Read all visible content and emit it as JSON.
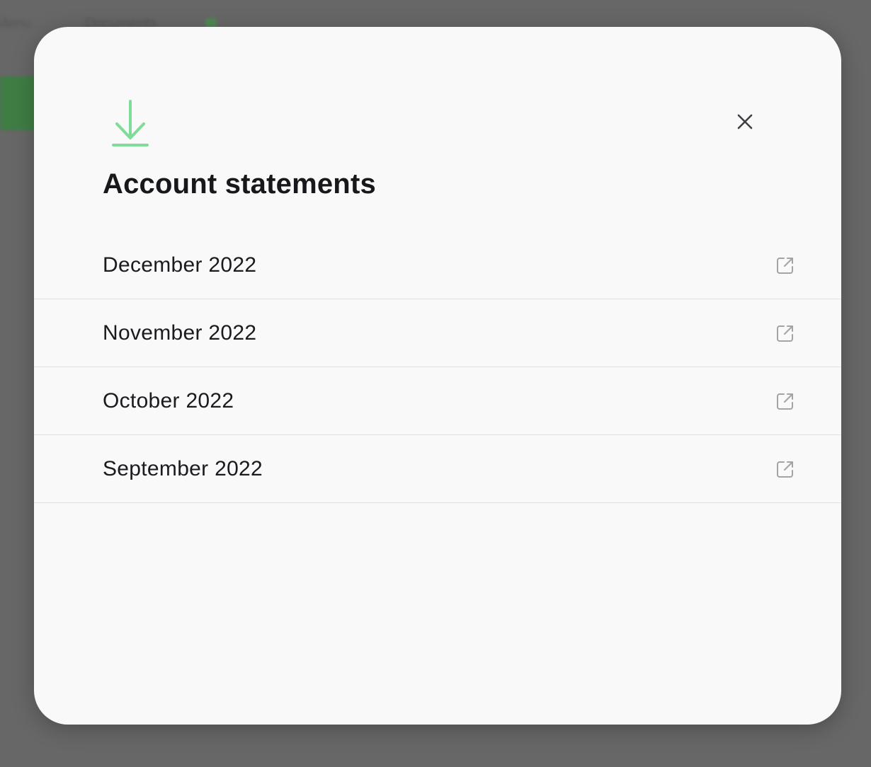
{
  "background": {
    "hints": [
      "Menu",
      "Documents"
    ]
  },
  "modal": {
    "title": "Account statements",
    "header_icon": "download-icon",
    "close_icon": "close-icon",
    "accent_color": "#7fdc98",
    "statements": [
      {
        "label": "December 2022",
        "icon": "external-link-icon"
      },
      {
        "label": "November 2022",
        "icon": "external-link-icon"
      },
      {
        "label": "October 2022",
        "icon": "external-link-icon"
      },
      {
        "label": "September 2022",
        "icon": "external-link-icon"
      }
    ]
  }
}
